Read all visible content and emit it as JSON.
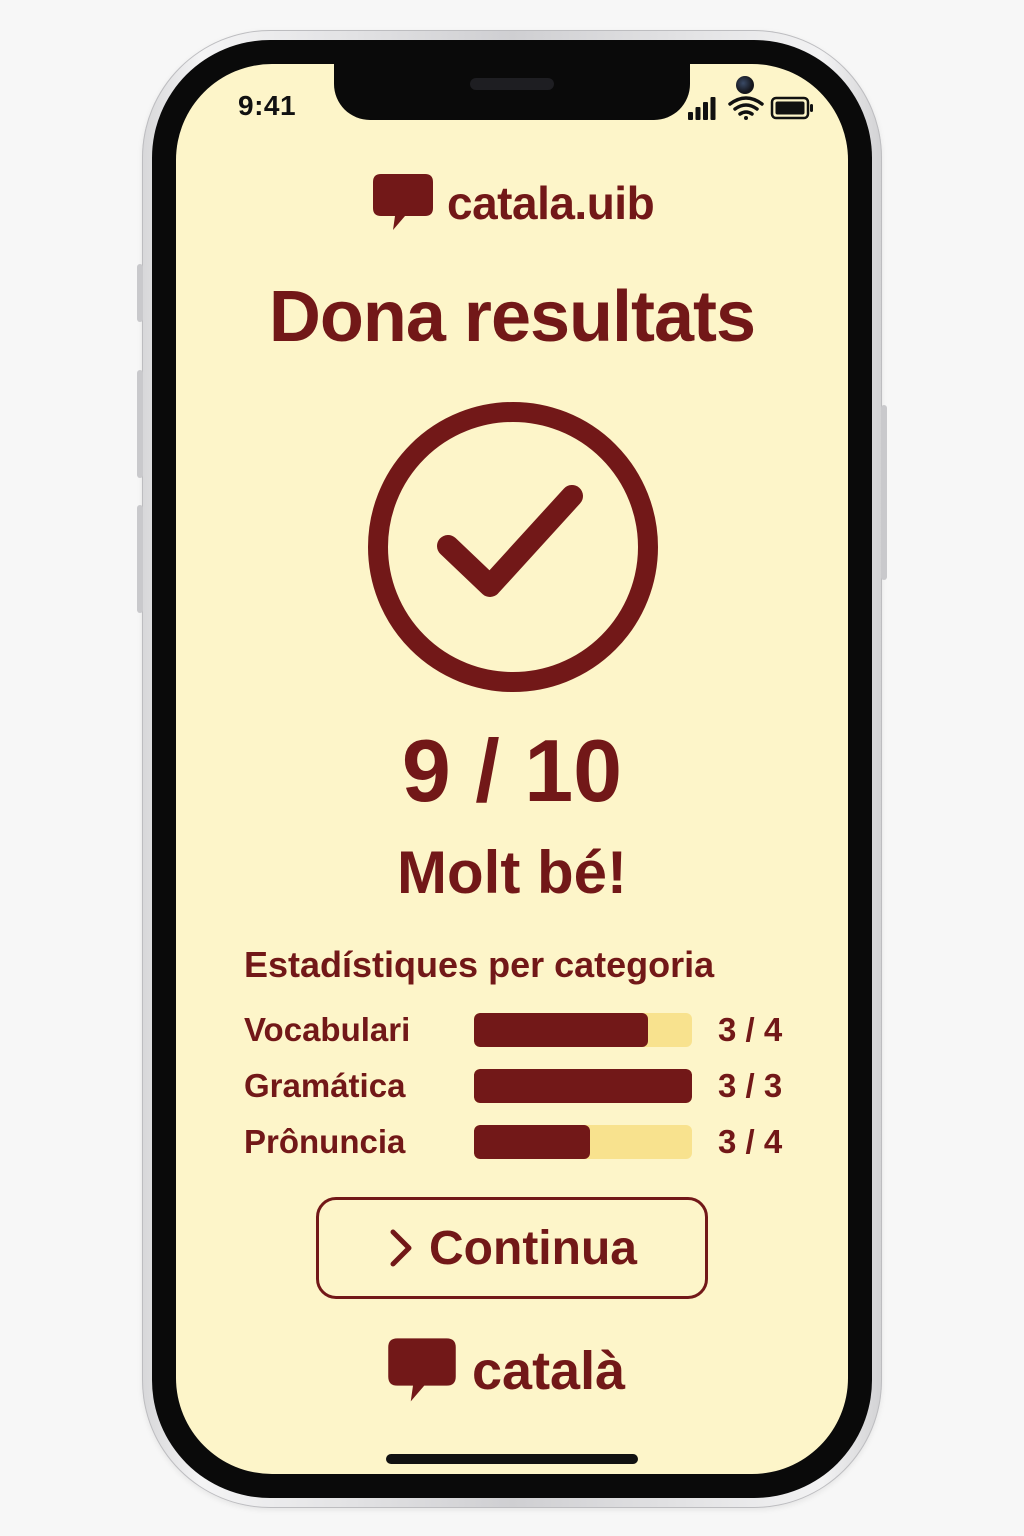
{
  "status_bar": {
    "time": "9:41",
    "icons": [
      "signal-icon",
      "wifi-icon",
      "battery-icon"
    ]
  },
  "brand_top": {
    "icon": "speech-bubble-icon",
    "name": "catala.uib"
  },
  "title": "Dona resultats",
  "result_icon": "checkmark-circle-icon",
  "score": "9 / 10",
  "verdict": "Molt bé!",
  "stats": {
    "heading": "Estadístiques per categoria",
    "rows": [
      {
        "label": "Vocabulari",
        "value": "3 / 4",
        "fill": 0.8
      },
      {
        "label": "Gramática",
        "value": "3 / 3",
        "fill": 1.0
      },
      {
        "label": "Prônuncia",
        "value": "3 / 4",
        "fill": 0.53
      }
    ]
  },
  "continue_button": {
    "icon": "chevron-right-icon",
    "label": "Continua"
  },
  "brand_bottom": {
    "icon": "speech-bubble-icon",
    "name": "català"
  },
  "colors": {
    "primary": "#721818",
    "background": "#fdf5c9",
    "bar_track": "#f8e28e"
  }
}
